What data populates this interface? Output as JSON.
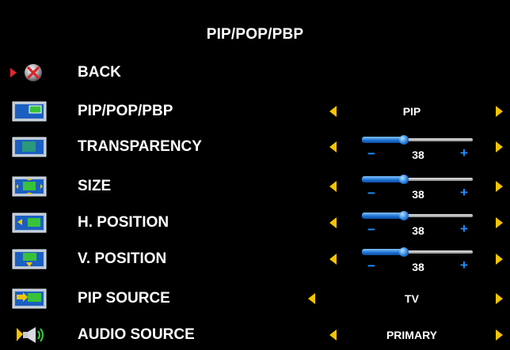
{
  "menu": {
    "title": "PIP/POP/PBP",
    "back_label": "BACK",
    "accent_color": "#f5c400",
    "slider_color": "#1e90ff",
    "items": [
      {
        "label": "PIP/POP/PBP",
        "icon": "pip-mode-icon",
        "value": "PIP"
      },
      {
        "label": "TRANSPARENCY",
        "icon": "transparency-icon",
        "value": 38
      },
      {
        "label": "SIZE",
        "icon": "pip-size-icon",
        "value": 38
      },
      {
        "label": "H. POSITION",
        "icon": "horizontal-position-icon",
        "value": 38
      },
      {
        "label": "V. POSITION",
        "icon": "vertical-position-icon",
        "value": 38
      },
      {
        "label": "PIP SOURCE",
        "icon": "pip-source-icon",
        "value": "TV"
      },
      {
        "label": "AUDIO SOURCE",
        "icon": "speaker-icon",
        "value": "PRIMARY"
      }
    ],
    "slider_minus": "−",
    "slider_plus": "+"
  }
}
